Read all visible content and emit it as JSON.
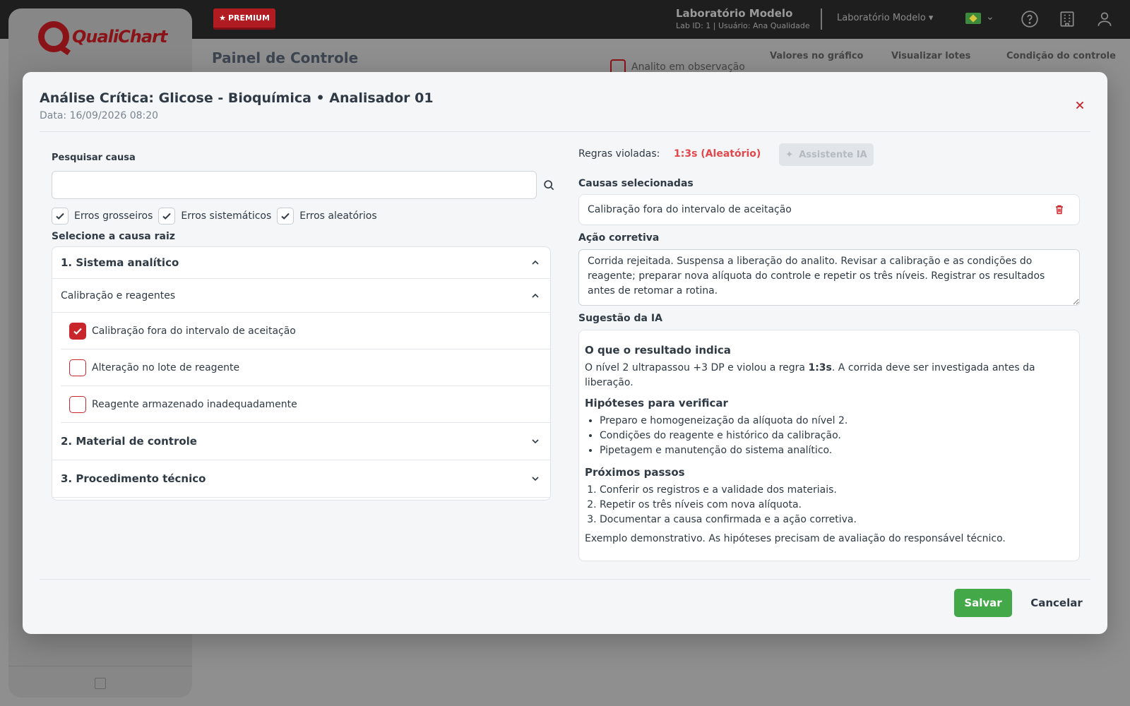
{
  "app": {
    "premium_label": "PREMIUM",
    "logo_text": "QualiChart",
    "lab_name": "Laboratório Modelo",
    "lab_sub": "Lab ID: 1 | Usuário: Ana Qualidade",
    "lab_select": "Laboratório Modelo ▾",
    "page_title": "Painel de Controle",
    "observe_label": "Analito em observação",
    "groups": [
      "Valores no gráfico",
      "Visualizar lotes",
      "Condição do controle"
    ]
  },
  "modal": {
    "title": "Análise Crítica: Glicose - Bioquímica • Analisador 01",
    "date": "Data: 16/09/2026 08:20",
    "search": {
      "label": "Pesquisar causa",
      "value": "",
      "placeholder": ""
    },
    "filters": [
      "Erros grosseiros",
      "Erros sistemáticos",
      "Erros aleatórios"
    ],
    "root_label": "Selecione a causa raiz",
    "tree": {
      "sections": [
        "1. Sistema analítico",
        "2. Material de controle",
        "3. Procedimento técnico"
      ],
      "subgroup": "Calibração e reagentes",
      "items": [
        {
          "label": "Calibração fora do intervalo de aceitação",
          "checked": true
        },
        {
          "label": "Alteração no lote de reagente",
          "checked": false
        },
        {
          "label": "Reagente armazenado inadequadamente",
          "checked": false
        }
      ]
    },
    "rules_label": "Regras violadas:",
    "rules_value": "1:3s (Aleatório)",
    "ai_button": "Assistente IA",
    "selected_label": "Causas selecionadas",
    "selected_cause": "Calibração fora do intervalo de aceitação",
    "action_label": "Ação corretiva",
    "action_text": "Corrida rejeitada. Suspensa a liberação do analito. Revisar a calibração e as condições do reagente; preparar nova alíquota do controle e repetir os três níveis. Registrar os resultados antes de retomar a rotina.",
    "suggestion_label": "Sugestão da IA",
    "suggestion": {
      "h1": "O que o resultado indica",
      "p1_a": "O nível 2 ultrapassou +3 DP e violou a regra ",
      "p1_rule": "1:3s",
      "p1_b": ". A corrida deve ser investigada antes da liberação.",
      "h2": "Hipóteses para verificar",
      "hypotheses": [
        "Preparo e homogeneização da alíquota do nível 2.",
        "Condições do reagente e histórico da calibração.",
        "Pipetagem e manutenção do sistema analítico."
      ],
      "h3": "Próximos passos",
      "steps": [
        "Conferir os registros e a validade dos materiais.",
        "Repetir os três níveis com nova alíquota.",
        "Documentar a causa confirmada e a ação corretiva."
      ],
      "note": "Exemplo demonstrativo. As hipóteses precisam de avaliação do responsável técnico."
    },
    "save_label": "Salvar",
    "cancel_label": "Cancelar"
  },
  "colors": {
    "brand_red": "#c9262b",
    "rule_red": "#e2474b",
    "save_green": "#43a948"
  }
}
